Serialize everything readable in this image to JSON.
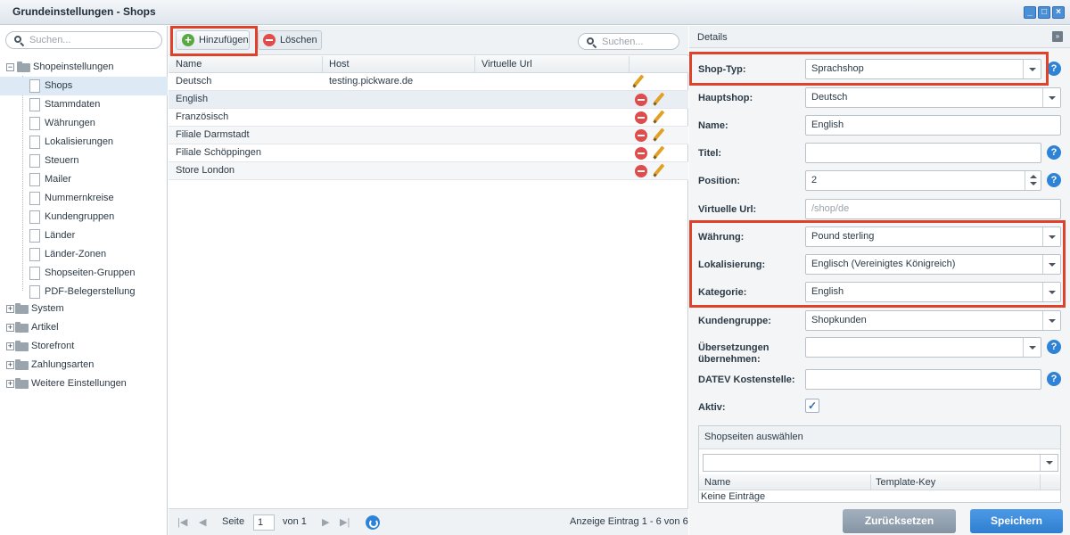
{
  "window": {
    "title": "Grundeinstellungen - Shops",
    "controls": [
      "minimize",
      "maximize",
      "close"
    ]
  },
  "tree": {
    "search_placeholder": "Suchen...",
    "root_expanded": {
      "label": "Shopeinstellungen",
      "toggle": "−"
    },
    "children": [
      {
        "label": "Shops",
        "selected": true
      },
      {
        "label": "Stammdaten"
      },
      {
        "label": "Währungen"
      },
      {
        "label": "Lokalisierungen"
      },
      {
        "label": "Steuern"
      },
      {
        "label": "Mailer"
      },
      {
        "label": "Nummernkreise"
      },
      {
        "label": "Kundengruppen"
      },
      {
        "label": "Länder"
      },
      {
        "label": "Länder-Zonen"
      },
      {
        "label": "Shopseiten-Gruppen"
      },
      {
        "label": "PDF-Belegerstellung"
      }
    ],
    "collapsed_roots": [
      {
        "label": "System",
        "toggle": "+"
      },
      {
        "label": "Artikel",
        "toggle": "+"
      },
      {
        "label": "Storefront",
        "toggle": "+"
      },
      {
        "label": "Zahlungsarten",
        "toggle": "+"
      },
      {
        "label": "Weitere Einstellungen",
        "toggle": "+"
      }
    ]
  },
  "toolbar": {
    "add_label": "Hinzufügen",
    "add_icon": "+",
    "delete_label": "Löschen",
    "search_placeholder": "Suchen..."
  },
  "grid": {
    "columns": [
      "Name",
      "Host",
      "Virtuelle Url"
    ],
    "rows": [
      {
        "name": "Deutsch",
        "host": "testing.pickware.de",
        "url": ""
      },
      {
        "name": "English",
        "host": "",
        "url": ""
      },
      {
        "name": "Französisch",
        "host": "",
        "url": ""
      },
      {
        "name": "Filiale Darmstadt",
        "host": "",
        "url": ""
      },
      {
        "name": "Filiale Schöppingen",
        "host": "",
        "url": ""
      },
      {
        "name": "Store London",
        "host": "",
        "url": ""
      }
    ]
  },
  "pager": {
    "first": "|◀",
    "prev": "◀",
    "page_label": "Seite",
    "page_value": "1",
    "of_label": "von 1",
    "next": "▶",
    "last": "▶|",
    "summary": "Anzeige Eintrag 1 - 6 von 6"
  },
  "details": {
    "title": "Details",
    "collapse_glyph": "»",
    "help_glyph": "?",
    "fields": {
      "shop_typ": {
        "label": "Shop-Typ:",
        "value": "Sprachshop"
      },
      "hauptshop": {
        "label": "Hauptshop:",
        "value": "Deutsch"
      },
      "name": {
        "label": "Name:",
        "value": "English"
      },
      "titel": {
        "label": "Titel:",
        "value": ""
      },
      "position": {
        "label": "Position:",
        "value": "2"
      },
      "virtuelle_url": {
        "label": "Virtuelle Url:",
        "placeholder": "/shop/de"
      },
      "waehrung": {
        "label": "Währung:",
        "value": "Pound sterling"
      },
      "lokalisierung": {
        "label": "Lokalisierung:",
        "value": "Englisch (Vereinigtes Königreich)"
      },
      "kategorie": {
        "label": "Kategorie:",
        "value": "English"
      },
      "kundengruppe": {
        "label": "Kundengruppe:",
        "value": "Shopkunden"
      },
      "uebersetzungen": {
        "label_line1": "Übersetzungen",
        "label_line2": "übernehmen:",
        "value": ""
      },
      "datev": {
        "label": "DATEV Kostenstelle:",
        "value": ""
      },
      "aktiv": {
        "label": "Aktiv:",
        "checked": true,
        "check_glyph": "✓"
      }
    },
    "shop_pages": {
      "title": "Shopseiten auswählen",
      "columns": [
        "Name",
        "Template-Key"
      ],
      "empty_text": "Keine Einträge"
    },
    "reset_label": "Zurücksetzen",
    "save_label": "Speichern"
  },
  "colors": {
    "highlight": "#e0412a",
    "primary": "#2f83d6",
    "delete": "#e14b4b",
    "add": "#5aa844"
  }
}
